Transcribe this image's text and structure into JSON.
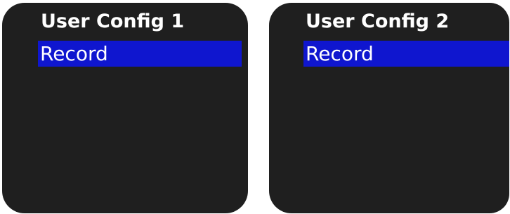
{
  "screens": [
    {
      "title": "User Config 1",
      "menu_items": [
        "Record"
      ],
      "selected_index": 0
    },
    {
      "title": "User Config 2",
      "menu_items": [
        "Record"
      ],
      "selected_index": 0
    }
  ],
  "colors": {
    "screen_background": "#1f1f1f",
    "selection_highlight": "#0f16cf",
    "text": "#ffffff",
    "page_background": "#ffffff"
  }
}
